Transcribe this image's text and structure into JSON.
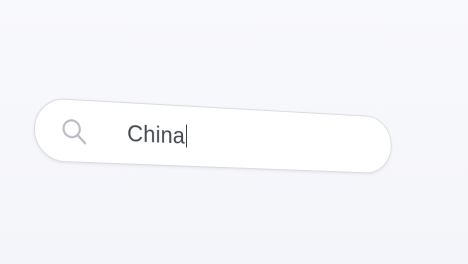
{
  "search": {
    "value": "China",
    "icon": "search-icon"
  }
}
